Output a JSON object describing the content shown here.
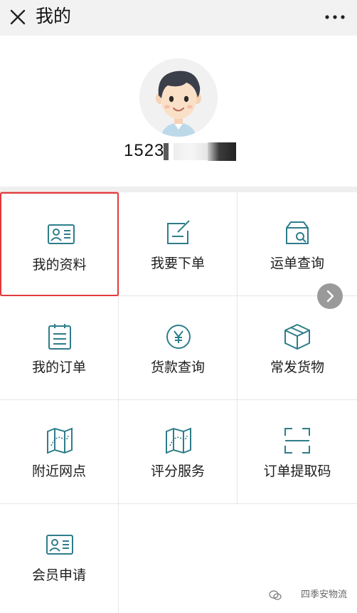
{
  "header": {
    "title": "我的"
  },
  "profile": {
    "phone_visible": "1523"
  },
  "menu": {
    "items": [
      {
        "label": "我的资料",
        "icon": "id-card-icon"
      },
      {
        "label": "我要下单",
        "icon": "edit-note-icon"
      },
      {
        "label": "运单查询",
        "icon": "box-search-icon"
      },
      {
        "label": "我的订单",
        "icon": "list-clipboard-icon"
      },
      {
        "label": "货款查询",
        "icon": "yen-coin-icon"
      },
      {
        "label": "常发货物",
        "icon": "parcel-box-icon"
      },
      {
        "label": "附近网点",
        "icon": "map-route-icon"
      },
      {
        "label": "评分服务",
        "icon": "map-route-icon"
      },
      {
        "label": "订单提取码",
        "icon": "scan-frame-icon"
      },
      {
        "label": "会员申请",
        "icon": "id-card-icon"
      }
    ]
  },
  "watermark": {
    "text": "四季安物流"
  },
  "colors": {
    "icon": "#2e7d8a",
    "highlight": "#e0393c"
  }
}
